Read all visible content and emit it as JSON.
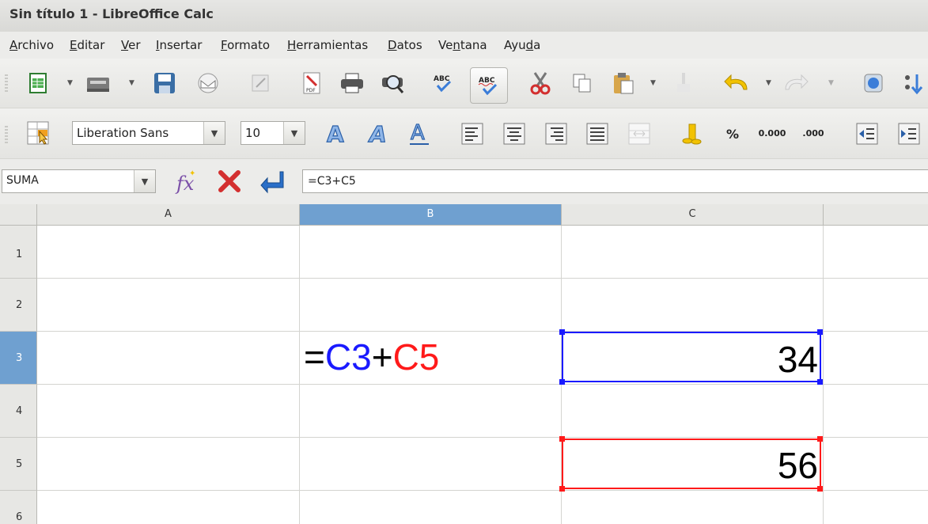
{
  "window": {
    "title": "Sin título 1 - LibreOffice Calc"
  },
  "menu": [
    {
      "pre": "",
      "ul": "A",
      "post": "rchivo"
    },
    {
      "pre": "",
      "ul": "E",
      "post": "ditar"
    },
    {
      "pre": "",
      "ul": "V",
      "post": "er"
    },
    {
      "pre": "",
      "ul": "I",
      "post": "nsertar"
    },
    {
      "pre": "",
      "ul": "F",
      "post": "ormato"
    },
    {
      "pre": "",
      "ul": "H",
      "post": "erramientas"
    },
    {
      "pre": "",
      "ul": "D",
      "post": "atos"
    },
    {
      "pre": "Ve",
      "ul": "n",
      "post": "tana"
    },
    {
      "pre": "Ayu",
      "ul": "d",
      "post": "a"
    }
  ],
  "format_bar": {
    "font_name": "Liberation Sans",
    "font_size": "10",
    "percent_label": "%",
    "decimal_add": "0.000",
    "decimal_remove": ".000"
  },
  "formula_bar": {
    "name_box": "SUMA",
    "formula": "=C3+C5"
  },
  "sheet": {
    "columns": [
      "A",
      "B",
      "C"
    ],
    "rows": [
      "1",
      "2",
      "3",
      "4",
      "5",
      "6"
    ],
    "selected_column": "B",
    "selected_row": "3",
    "cells": {
      "B3": {
        "eq": "=",
        "ref1": "C3",
        "plus": "+",
        "ref2": "C5"
      },
      "C3": "34",
      "C5": "56"
    },
    "colors": {
      "ref1": "#1a1aff",
      "ref2": "#ff1a1a",
      "selection": "#6fa0d0"
    }
  }
}
